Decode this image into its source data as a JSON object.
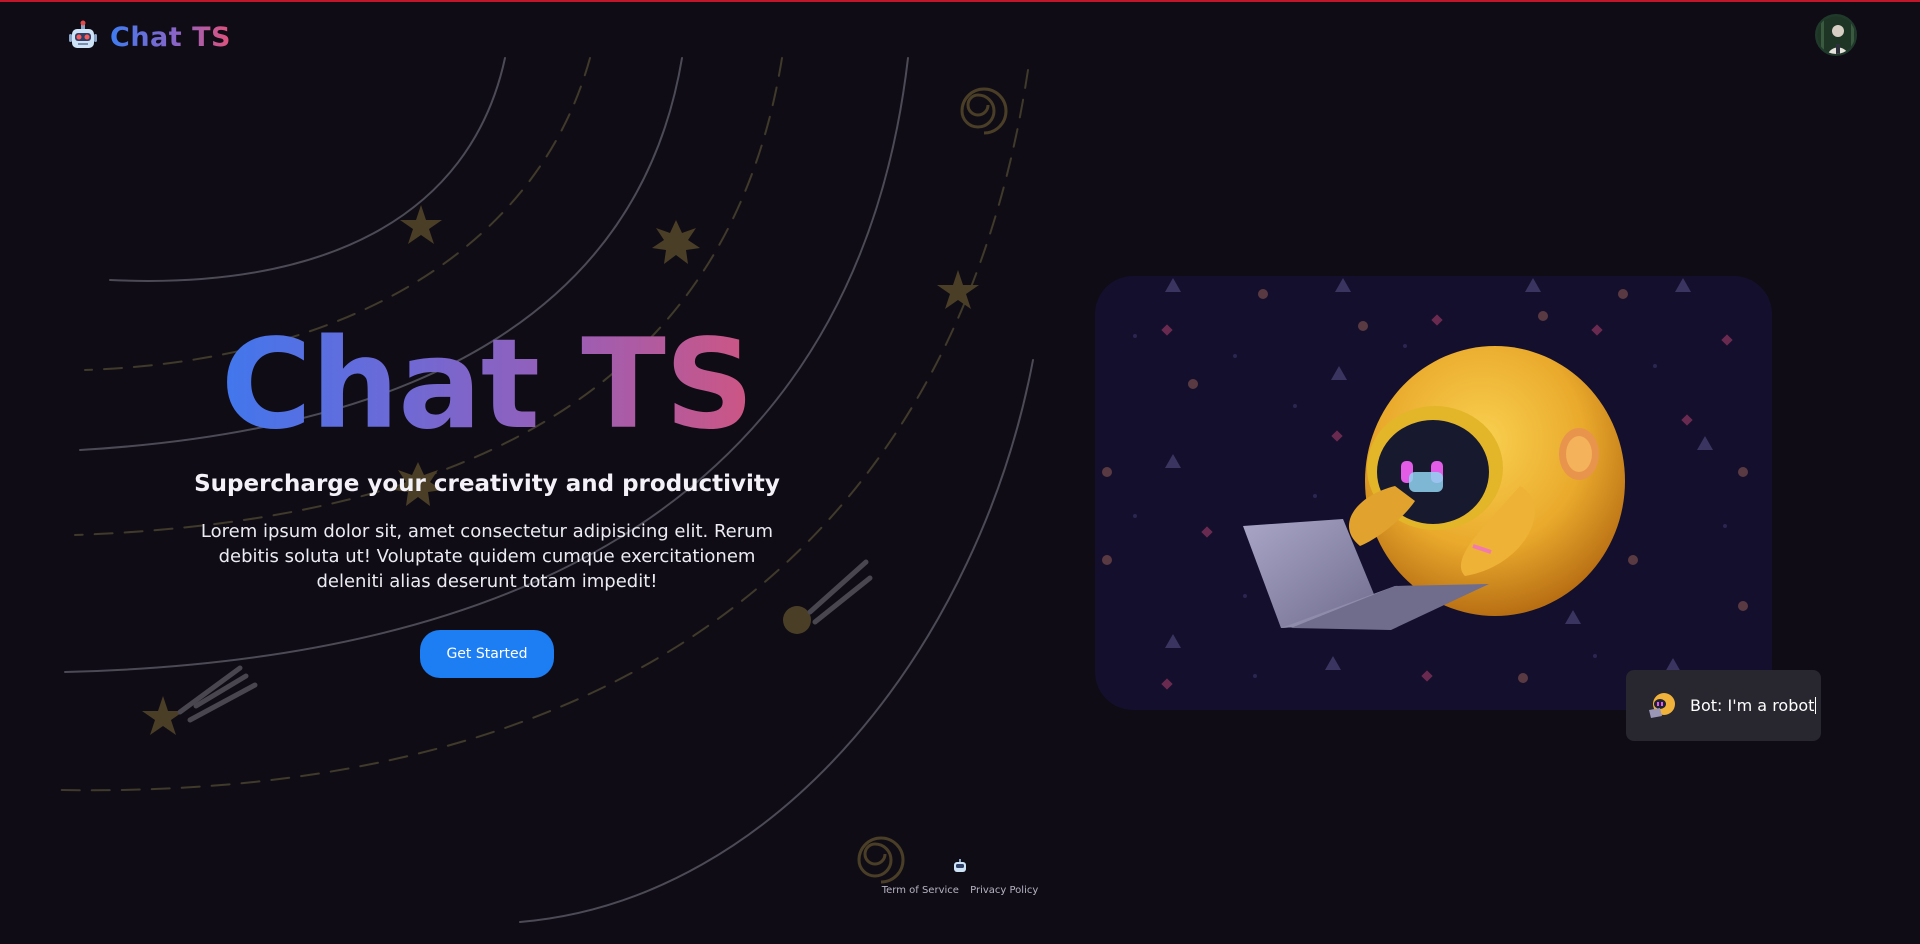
{
  "header": {
    "brand": "Chat TS",
    "logo_icon": "robot-icon",
    "avatar": "user-avatar"
  },
  "hero": {
    "title": "Chat TS",
    "subtitle": "Supercharge your creativity and productivity",
    "description": "Lorem ipsum dolor sit, amet consectetur adipisicing elit. Rerum debitis soluta ut! Voluptate quidem cumque exercitationem deleniti alias deserunt totam impedit!",
    "cta_label": "Get Started"
  },
  "chat_bubble": {
    "text": "Bot: I'm a robot",
    "icon": "robot-emoji-icon"
  },
  "footer": {
    "links": [
      "Term of Service",
      "Privacy Policy"
    ]
  },
  "colors": {
    "background": "#0f0c16",
    "accent_blue": "#1d7df2",
    "brand_gradient_start": "#2f7cf6",
    "brand_gradient_end": "#e2526f",
    "card_background": "#140f2c",
    "bubble_background": "#28262f",
    "top_border": "#c0182a"
  }
}
